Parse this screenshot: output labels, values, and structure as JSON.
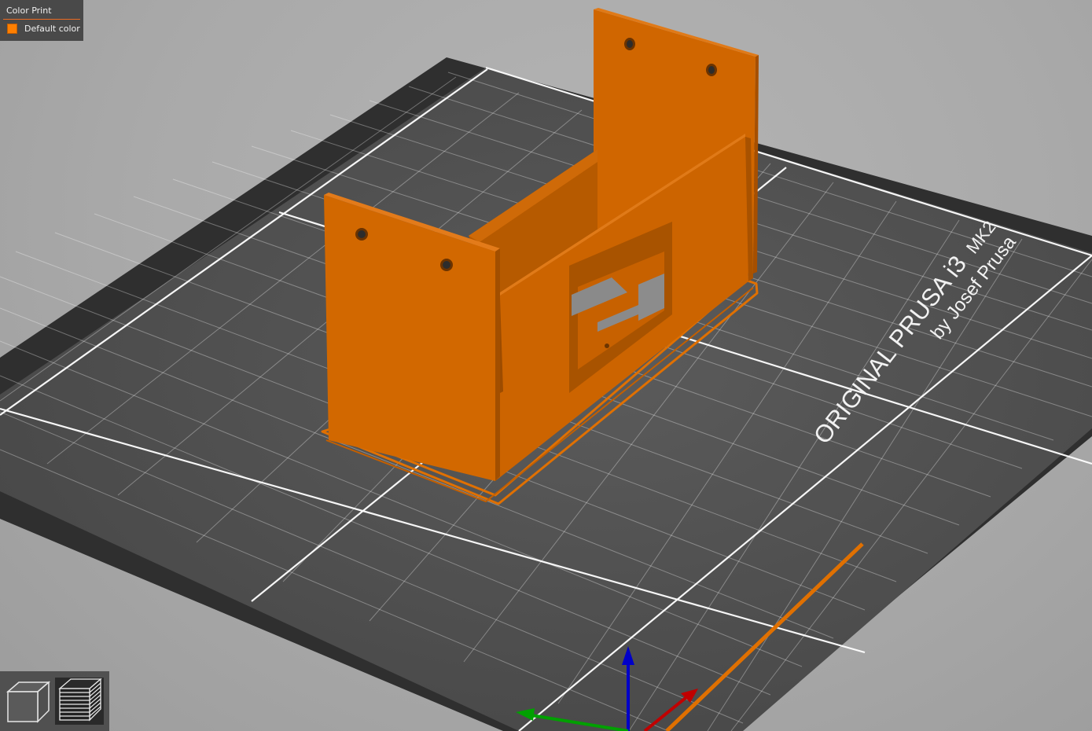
{
  "legend": {
    "title": "Color Print",
    "items": [
      {
        "label": "Default color",
        "color": "#ff7f00"
      }
    ]
  },
  "bed": {
    "brand_line1_a": "ORIGINAL PRUSA i3",
    "brand_line1_b": "MK2",
    "brand_line2": "by Josef Prusa"
  },
  "view_toolbar": {
    "buttons": [
      {
        "name": "3d-view",
        "icon": "cube-icon",
        "active": false
      },
      {
        "name": "preview",
        "icon": "layers-icon",
        "active": true
      }
    ]
  },
  "colors": {
    "background": "#a9a9a9",
    "bed_plate": "#505050",
    "bed_frame": "#2f2f2f",
    "grid_lines": "#ffffff",
    "model": "#d96a00",
    "model_shadow": "#9a4a00",
    "axis_x": "#c00000",
    "axis_y": "#00a000",
    "axis_z": "#0000c8"
  }
}
